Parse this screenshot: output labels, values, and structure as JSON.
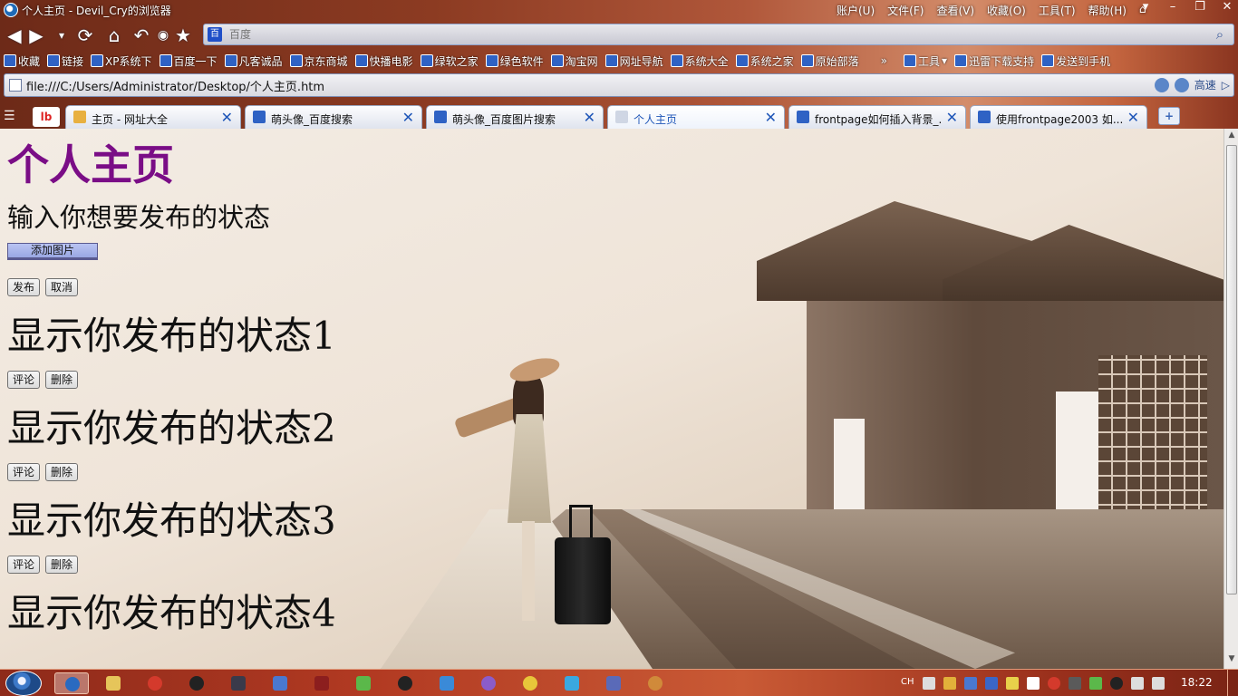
{
  "window": {
    "title": "个人主页 - Devil_Cry的浏览器",
    "menus": [
      "账户(U)",
      "文件(F)",
      "查看(V)",
      "收藏(O)",
      "工具(T)",
      "帮助(H)"
    ]
  },
  "search": {
    "placeholder": "百度"
  },
  "favorites": {
    "items": [
      "收藏",
      "链接",
      "XP系统下",
      "百度一下",
      "凡客诚品",
      "京东商城",
      "快播电影",
      "绿软之家",
      "绿色软件",
      "淘宝网",
      "网址导航",
      "系统大全",
      "系统之家",
      "原始部落"
    ],
    "overflow": "»",
    "tools_label": "工具",
    "xunlei": "迅雷下载支持",
    "send_phone": "发送到手机"
  },
  "address": {
    "url": "file:///C:/Users/Administrator/Desktop/个人主页.htm",
    "speed_label": "高速"
  },
  "tabs": [
    {
      "label": "主页 - 网址大全"
    },
    {
      "label": "萌头像_百度搜索"
    },
    {
      "label": "萌头像_百度图片搜索"
    },
    {
      "label": "个人主页"
    },
    {
      "label": "frontpage如何插入背景_..."
    },
    {
      "label": "使用frontpage2003 如..."
    }
  ],
  "page": {
    "title": "个人主页",
    "prompt": "输入你想要发布的状态",
    "add_image_label": "添加图片",
    "publish_label": "发布",
    "cancel_label": "取消",
    "comment_label": "评论",
    "delete_label": "删除",
    "posts": [
      {
        "text": "显示你发布的状态1"
      },
      {
        "text": "显示你发布的状态2"
      },
      {
        "text": "显示你发布的状态3"
      },
      {
        "text": "显示你发布的状态4"
      }
    ]
  },
  "taskbar": {
    "lang": "CH",
    "clock": "18:22"
  },
  "colors": {
    "page_title": "#7a0d86",
    "chrome_accent": "#8c3b22",
    "tab_active_text": "#1f56b8"
  }
}
